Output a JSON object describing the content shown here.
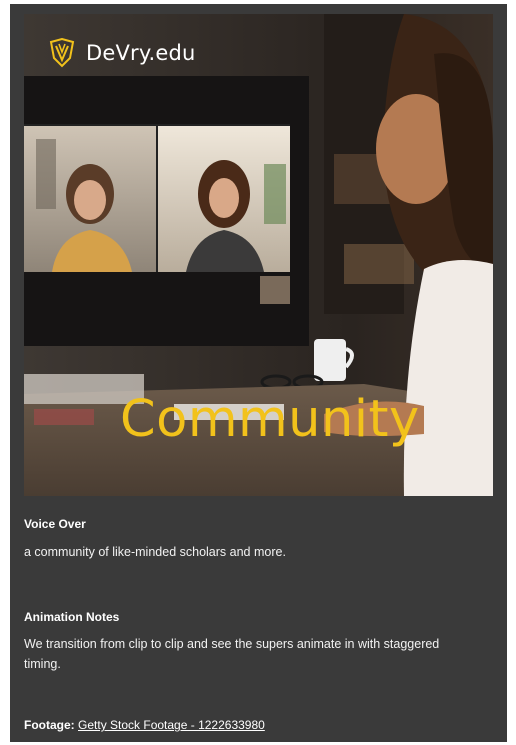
{
  "frame": {
    "logo_text": "DeVry.edu",
    "super_text": "Community",
    "colors": {
      "super": "#f2c21b",
      "logo_mark": "#f2c21b",
      "panel_bg": "#3a3a3a"
    }
  },
  "notes": {
    "voice_over_heading": "Voice Over",
    "voice_over_text": "a community of like-minded scholars and more.",
    "animation_heading": "Animation Notes",
    "animation_text": "We transition from clip to clip and see the supers animate in with staggered timing.",
    "footage_label": "Footage:",
    "footage_link": "Getty Stock Footage - 1222633980"
  }
}
